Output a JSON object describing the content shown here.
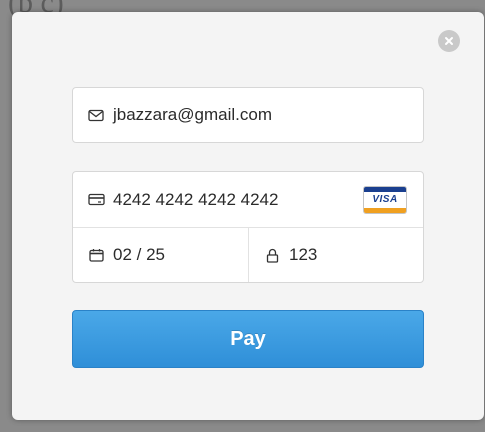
{
  "backdrop": {
    "partial_text": "(b c)"
  },
  "modal": {
    "close_icon": "close-icon"
  },
  "form": {
    "email": {
      "value": "jbazzara@gmail.com",
      "icon": "envelope-icon"
    },
    "card_number": {
      "value": "4242 4242 4242 4242",
      "icon": "credit-card-icon",
      "brand": "VISA"
    },
    "expiry": {
      "value": "02 / 25",
      "icon": "calendar-icon"
    },
    "cvc": {
      "value": "123",
      "icon": "lock-icon"
    },
    "pay_label": "Pay"
  },
  "colors": {
    "accent": "#3a9be0",
    "modal_bg": "#f4f4f4",
    "field_border": "#d7d7d7",
    "visa_blue": "#1a3f8f",
    "visa_gold": "#f0a020"
  }
}
